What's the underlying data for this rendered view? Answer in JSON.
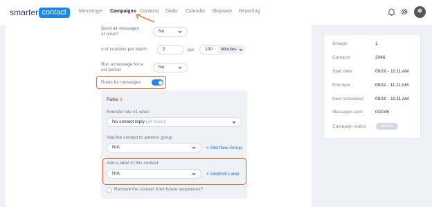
{
  "header": {
    "logo_text": "smarter",
    "logo_badge": "contact",
    "nav": [
      "Messenger",
      "Campaigns",
      "Contacts",
      "Dialer",
      "Calendar",
      "Skiptrace",
      "Reporting"
    ],
    "active_nav": "Campaigns",
    "icons": [
      "bell-icon",
      "gear-icon",
      "avatar"
    ]
  },
  "form": {
    "send_all_label": "Send all messages at once?",
    "send_all_value": "No",
    "contacts_per_batch_label": "# of contacts per batch",
    "contacts_per_batch_value": "2",
    "per_label": "per",
    "per_value": "100",
    "per_unit": "Minutes",
    "run_message_label": "Run a message for a set period",
    "run_message_value": "No",
    "rules_toggle_label": "Rules for messages",
    "rules_toggle_on": true
  },
  "rules": {
    "title": "Rules",
    "title_icon": "lightning-icon",
    "execute_label": "Execute rule #1 when",
    "execute_value": "No contact reply",
    "execute_hint": "(24 hours)",
    "add_group_label": "Add the contact to another group",
    "group_value": "N/A",
    "add_group_link": "+ Add New Group",
    "add_label_label": "Add a label to this contact",
    "label_value": "N/A",
    "add_label_link": "+ Add/Edit Label",
    "remove_label": "Remove the contact from future sequences?",
    "remove_checked": false
  },
  "stats": [
    {
      "label": "Groups",
      "value": "1"
    },
    {
      "label": "Contacts",
      "value": "2046"
    },
    {
      "label": "Start date",
      "value": "09/10 - 11:11 AM"
    },
    {
      "label": "End date",
      "value": "09/11 - 11:11 AM"
    },
    {
      "label": "Next scheduled",
      "value": "09/10 - 11:11 AM"
    },
    {
      "label": "Messages sent",
      "value": "0/2046"
    },
    {
      "label": "Campaign status",
      "value": "Inactive"
    }
  ],
  "colors": {
    "accent": "#1b86e3",
    "highlight": "#e5622d",
    "toggle": "#2585e8"
  }
}
